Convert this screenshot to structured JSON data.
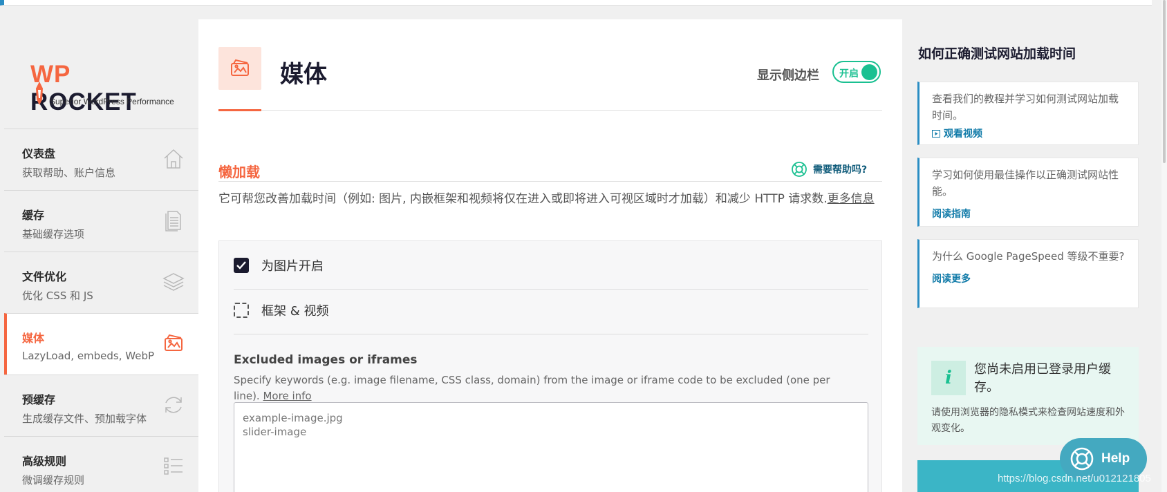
{
  "brand": {
    "logo_text_wp": "WP",
    "logo_text_rocket": "ROCKET",
    "tagline": "Superior WordPress Performance",
    "accent": "#f56640"
  },
  "nav": {
    "items": [
      {
        "title": "仪表盘",
        "desc": "获取帮助、账户信息",
        "icon": "home-icon"
      },
      {
        "title": "缓存",
        "desc": "基础缓存选项",
        "icon": "document-icon"
      },
      {
        "title": "文件优化",
        "desc": "优化 CSS 和 JS",
        "icon": "layers-icon"
      },
      {
        "title": "媒体",
        "desc": "LazyLoad, embeds, WebP",
        "icon": "media-icon",
        "active": true
      },
      {
        "title": "预缓存",
        "desc": "生成缓存文件、预加载字体",
        "icon": "refresh-icon"
      },
      {
        "title": "高级规则",
        "desc": "微调缓存规则",
        "icon": "list-icon"
      }
    ]
  },
  "page": {
    "title": "媒体",
    "sidebar_toggle_label": "显示侧边栏",
    "sidebar_toggle_state": "开启"
  },
  "lazyload": {
    "title": "懒加载",
    "help_label": "需要帮助吗?",
    "description": "它可帮您改善加载时间（例如: 图片, 内嵌框架和视频将仅在进入或即将进入可视区域时才加载）和减少 HTTP 请求数.",
    "more_link": "更多信息",
    "options": [
      {
        "label": "为图片开启",
        "checked": true
      },
      {
        "label": "框架 & 视频",
        "checked": false
      }
    ],
    "excluded": {
      "title": "Excluded images or iframes",
      "description": "Specify keywords (e.g. image filename, CSS class, domain) from the image or iframe code to be excluded (one per line).",
      "more_link": "More info",
      "placeholder": "example-image.jpg\nslider-image"
    }
  },
  "aside": {
    "title": "如何正确测试网站加载时间",
    "cards": [
      {
        "text": "查看我们的教程并学习如何测试网站加载时间。",
        "link": "观看视频"
      },
      {
        "text": "学习如何使用最佳操作以正确测试网站性能。",
        "link": "阅读指南"
      },
      {
        "text": "为什么 Google PageSpeed 等级不重要?",
        "link": "阅读更多"
      }
    ],
    "notice": {
      "icon_letter": "i",
      "title": "您尚未启用已登录用户缓存。",
      "text": "请使用浏览器的隐私模式来检查网站速度和外观变化。"
    }
  },
  "help_button": {
    "label": "Help"
  },
  "watermark": "https://blog.csdn.net/u012121805"
}
